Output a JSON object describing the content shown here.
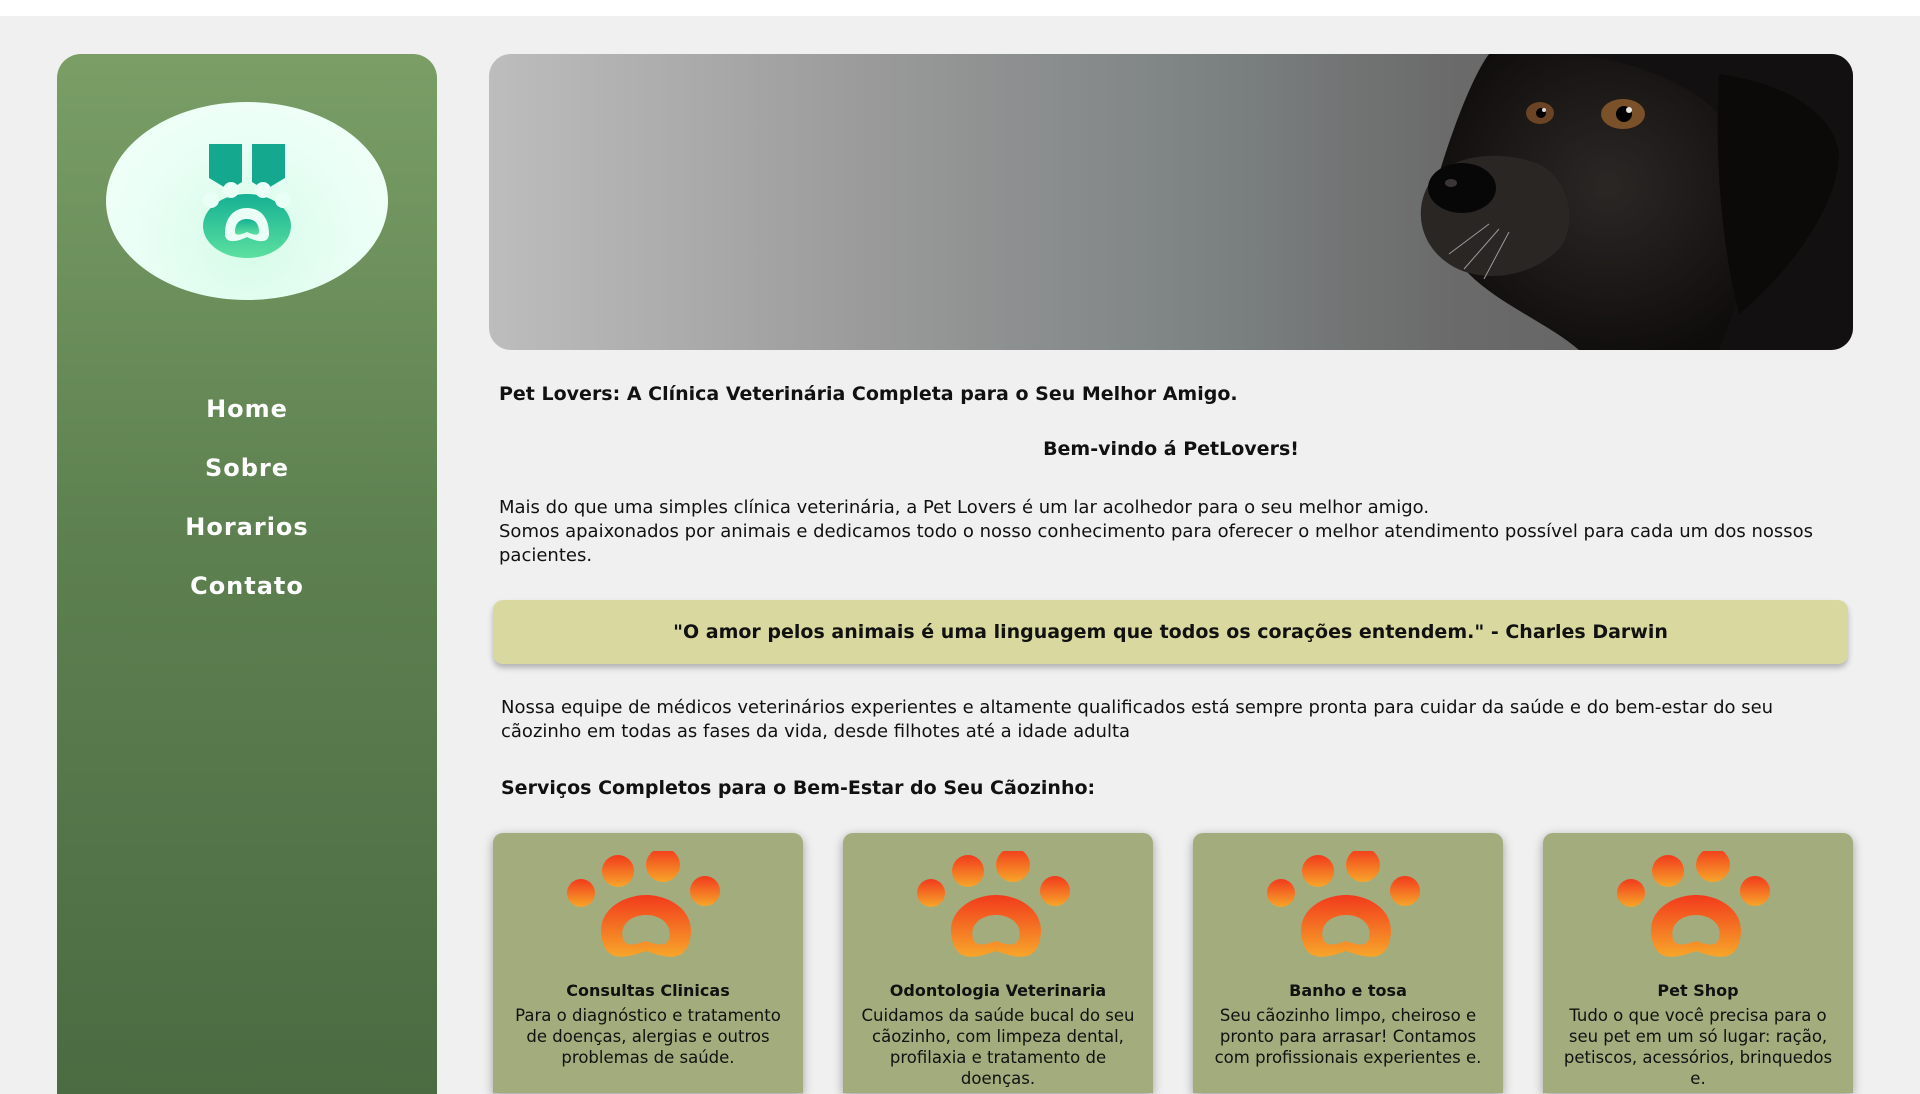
{
  "nav": {
    "items": [
      {
        "label": "Home"
      },
      {
        "label": "Sobre"
      },
      {
        "label": "Horarios"
      },
      {
        "label": "Contato"
      }
    ]
  },
  "hero": {
    "image": "black-dog-photo"
  },
  "main": {
    "headline": "Pet Lovers: A Clínica Veterinária Completa para o Seu Melhor Amigo.",
    "welcome": "Bem-vindo á PetLovers!",
    "intro_line1": "Mais do que uma simples clínica veterinária, a Pet Lovers é um lar acolhedor para o seu melhor amigo.",
    "intro_line2": "Somos apaixonados por animais e dedicamos todo o nosso conhecimento para oferecer o melhor atendimento possível para cada um dos nossos pacientes.",
    "quote": "\"O amor pelos animais é uma linguagem que todos os corações entendem.\" - Charles Darwin",
    "team": "Nossa equipe de médicos veterinários experientes e altamente qualificados está sempre pronta para cuidar da saúde e do bem-estar do seu cãozinho em todas as fases da vida, desde filhotes até a idade adulta",
    "services_title": "Serviços Completos para o Bem-Estar do Seu Cãozinho:"
  },
  "services": [
    {
      "title": "Consultas Clinicas",
      "desc": "Para o diagnóstico e tratamento de doenças, alergias e outros problemas de saúde."
    },
    {
      "title": "Odontologia Veterinaria",
      "desc": "Cuidamos da saúde bucal do seu cãozinho, com limpeza dental, profilaxia e tratamento de doenças."
    },
    {
      "title": "Banho e tosa",
      "desc": "Seu cãozinho limpo, cheiroso e pronto para arrasar! Contamos com profissionais experientes e."
    },
    {
      "title": "Pet Shop",
      "desc": "Tudo o que você precisa para o seu pet em um só lugar: ração, petiscos, acessórios, brinquedos e."
    }
  ],
  "colors": {
    "sidebar_top": "#7a9e66",
    "sidebar_bottom": "#4b6b42",
    "quote_bg": "#d9d99f",
    "card_bg": "#a3ac7d",
    "paw_top": "#f23a1c",
    "paw_bottom": "#f7a62a",
    "logo_teal": "#17b79a"
  }
}
